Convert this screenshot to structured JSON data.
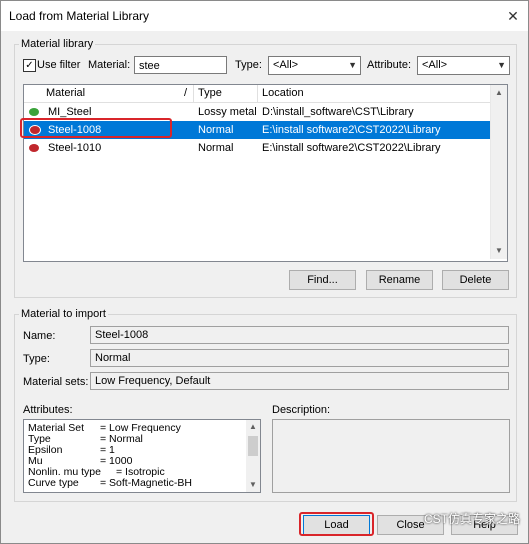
{
  "window": {
    "title": "Load from Material Library",
    "close_glyph": "✕"
  },
  "library": {
    "group_label": "Material library",
    "use_filter_label": "Use filter",
    "use_filter_checked": true,
    "material_label": "Material:",
    "material_value": "stee",
    "type_label": "Type:",
    "type_value": "<All>",
    "attribute_label": "Attribute:",
    "attribute_value": "<All>",
    "columns": [
      "Material",
      "Type",
      "Location"
    ],
    "sort_indicator": "/",
    "rows": [
      {
        "material": "MI_Steel",
        "type": "Lossy metal",
        "location": "D:\\install_software\\CST\\Library",
        "icon_color": "#3aa33a",
        "selected": false
      },
      {
        "material": "Steel-1008",
        "type": "Normal",
        "location": "E:\\install software2\\CST2022\\Library",
        "icon_color": "#c0272d",
        "selected": true
      },
      {
        "material": "Steel-1010",
        "type": "Normal",
        "location": "E:\\install software2\\CST2022\\Library",
        "icon_color": "#c0272d",
        "selected": false
      }
    ],
    "buttons": {
      "find": "Find...",
      "rename": "Rename",
      "delete": "Delete"
    }
  },
  "import": {
    "group_label": "Material to import",
    "name_label": "Name:",
    "name_value": "Steel-1008",
    "type_label": "Type:",
    "type_value": "Normal",
    "sets_label": "Material sets:",
    "sets_value": "Low Frequency, Default",
    "attributes_label": "Attributes:",
    "description_label": "Description:",
    "attributes": [
      {
        "key": "Material Set",
        "value": "= Low Frequency"
      },
      {
        "key": "Type",
        "value": "= Normal"
      },
      {
        "key": "Epsilon",
        "value": "= 1"
      },
      {
        "key": "Mu",
        "value": "= 1000"
      },
      {
        "key": "Nonlin. mu type",
        "value": "= Isotropic"
      },
      {
        "key": "Curve type",
        "value": "= Soft-Magnetic-BH"
      }
    ]
  },
  "footer": {
    "load": "Load",
    "close": "Close",
    "help": "Help"
  },
  "watermark": "CST仿真专家之路"
}
